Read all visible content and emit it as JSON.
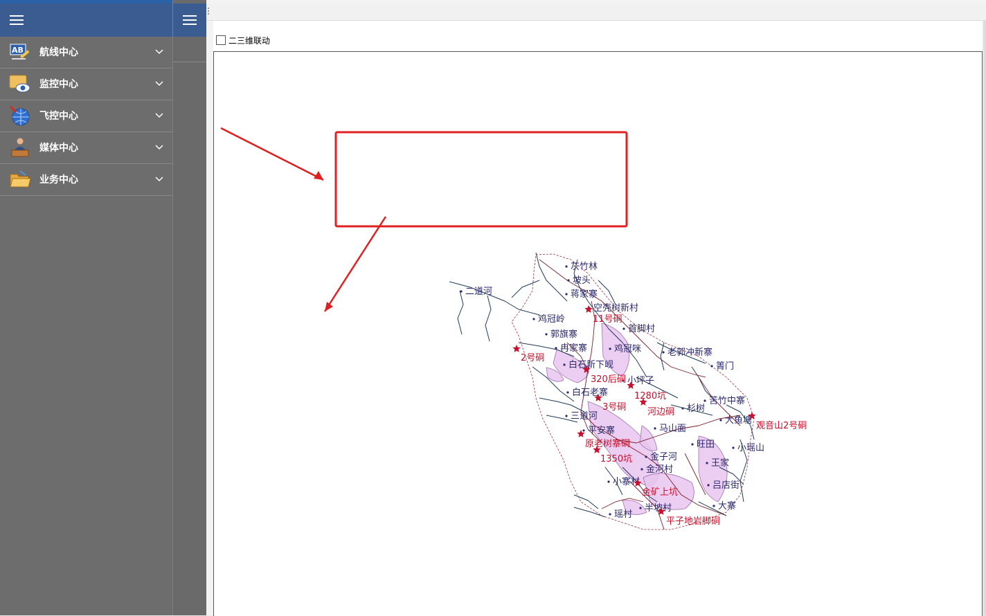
{
  "sidebar": {
    "items": [
      {
        "label": "航线中心",
        "icon": "ab-pencil-icon"
      },
      {
        "label": "监控中心",
        "icon": "monitor-eye-icon"
      },
      {
        "label": "飞控中心",
        "icon": "globe-icon"
      },
      {
        "label": "媒体中心",
        "icon": "presenter-icon"
      },
      {
        "label": "业务中心",
        "icon": "folder-icon"
      }
    ]
  },
  "map_panel": {
    "sync_2d_3d_label": "二三维联动",
    "sync_2d_3d_checked": false
  },
  "map": {
    "place_labels": [
      "灰竹林",
      "坡头",
      "蒋家寨",
      "二道河",
      "空壳树新村",
      "鸡冠岭",
      "首脚村",
      "郭旗寨",
      "冉家寨",
      "鸡冠咪",
      "老郭冲新寨",
      "白石新下岘",
      "箐门",
      "小坪子",
      "白石老寨",
      "苦竹中寨",
      "杉树",
      "三道河",
      "马山面",
      "平安寨",
      "大鱼塘",
      "旺田",
      "小瑶山",
      "金子河",
      "王家",
      "金河村",
      "小寨村",
      "吕店街",
      "大寨",
      "半坡村",
      "瑶村"
    ],
    "mine_labels": [
      "11号硐",
      "2号硐",
      "320后硐",
      "1280坑",
      "3号硐",
      "河边硐",
      "观音山2号硐",
      "原老树寨硐",
      "1350坑",
      "金矿上坑",
      "平子地岩脚硐"
    ],
    "colors": {
      "place": "#2b2a6e",
      "mine": "#c8102e",
      "river": "#1f3a5a",
      "road": "#7a1f2a",
      "zone": "#e8c6ef",
      "annotation": "#e02020"
    }
  }
}
